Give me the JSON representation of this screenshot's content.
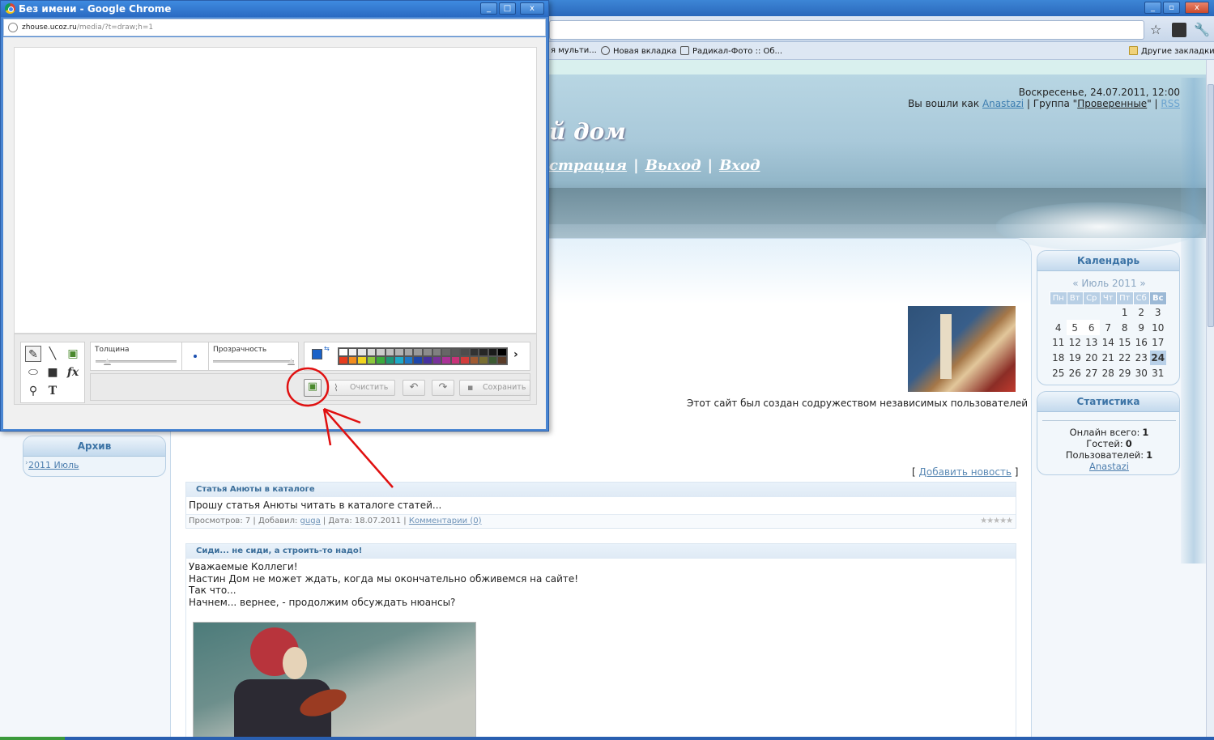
{
  "popup": {
    "title": "Без имени - Google Chrome",
    "url_host": "zhouse.ucoz.ru",
    "url_path": "/media/?t=draw;h=1",
    "window_controls": {
      "minimize": "_",
      "maximize": "□",
      "close": "x"
    },
    "toolbar": {
      "thickness_label": "Толщина",
      "opacity_label": "Прозрачность",
      "clear_label": "Очистить",
      "save_label": "Сохранить",
      "fx_label": "fx",
      "text_tool_label": "T",
      "current_color": "#1a62c8",
      "palette_top": [
        "#ffffff",
        "#f2f2f2",
        "#e6e6e6",
        "#d9d9d9",
        "#cccccc",
        "#bfbfbf",
        "#b3b3b3",
        "#a6a6a6",
        "#999999",
        "#8c8c8c",
        "#808080",
        "#666666",
        "#595959",
        "#4d4d4d",
        "#333333",
        "#262626",
        "#1a1a1a",
        "#000000"
      ],
      "palette_bottom": [
        "#e63c1e",
        "#f28c1e",
        "#f2d41e",
        "#8cc83c",
        "#3caa3c",
        "#1e9678",
        "#1eaac8",
        "#1e78c8",
        "#1e46aa",
        "#4632a0",
        "#78329b",
        "#aa3296",
        "#c83278",
        "#d23c3c",
        "#a05a32",
        "#786e32",
        "#3c5a32",
        "#5a3c28"
      ]
    }
  },
  "browser": {
    "window_controls": {
      "minimize": "_",
      "maximize": "▫",
      "close": "x"
    },
    "bookmarks": [
      {
        "label": "я мульти..."
      },
      {
        "label": "Новая вкладка"
      },
      {
        "label": "Радикал-Фото :: Об..."
      }
    ],
    "other_bookmarks": "Другие закладки"
  },
  "header": {
    "date": "Воскресенье, 24.07.2011, 12:00",
    "logged_as": "Вы вошли как",
    "user": "Anastazi",
    "group_prefix": "| Группа \"",
    "group": "Проверенные",
    "group_suffix": "\" |",
    "rss": "RSS",
    "site_title": "й дом",
    "nav": [
      "страция",
      "Выход",
      "Вход"
    ]
  },
  "main": {
    "slogan": "Этот сайт был создан содружеством независимых пользователей",
    "add_news_open": "[ ",
    "add_news": "Добавить новость",
    "add_news_close": " ]",
    "entries": [
      {
        "title": "Статья Анюты в каталоге",
        "body": "Прошу статья Анюты читать в каталоге статей...",
        "views_label": "Просмотров: 7 | Добавил: ",
        "author": "guga",
        "date_label": " | Дата: 18.07.2011 | ",
        "comments": "Комментарии (0)"
      },
      {
        "title": "Сиди... не сиди, а строить-то надо!",
        "lines": [
          "Уважаемые Коллеги!",
          "Настин Дом не может ждать, когда мы окончательно обживемся на сайте!",
          "Так что...",
          "Начнем... вернее, - продолжим обсуждать нюансы?"
        ]
      }
    ]
  },
  "sidebar": {
    "archive_title": "Архив",
    "archive_link": "2011 Июль",
    "calendar_title": "Календарь",
    "calendar_month": "«  Июль 2011  »",
    "weekdays": [
      "Пн",
      "Вт",
      "Ср",
      "Чт",
      "Пт",
      "Сб",
      "Вс"
    ],
    "weeks": [
      [
        "",
        "",
        "",
        "",
        "1",
        "2",
        "3"
      ],
      [
        "4",
        "5",
        "6",
        "7",
        "8",
        "9",
        "10"
      ],
      [
        "11",
        "12",
        "13",
        "14",
        "15",
        "16",
        "17"
      ],
      [
        "18",
        "19",
        "20",
        "21",
        "22",
        "23",
        "24"
      ],
      [
        "25",
        "26",
        "27",
        "28",
        "29",
        "30",
        "31"
      ]
    ],
    "stats_title": "Статистика",
    "online_label": "Онлайн всего:",
    "online": "1",
    "guests_label": "Гостей:",
    "guests": "0",
    "users_label": "Пользователей:",
    "users": "1",
    "online_user": "Anastazi"
  }
}
